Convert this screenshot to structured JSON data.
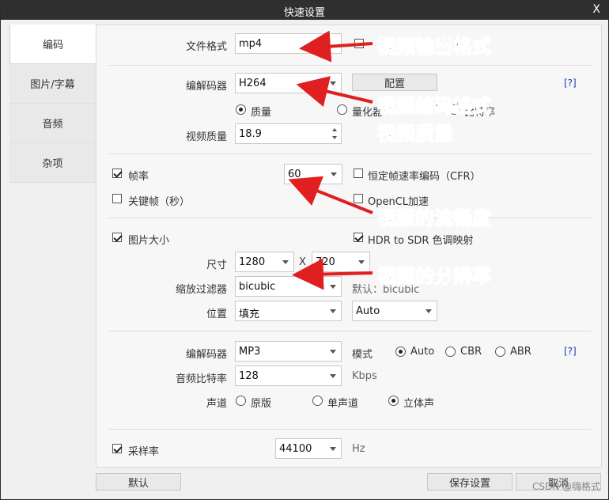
{
  "window": {
    "title": "快速设置",
    "close": "X"
  },
  "sidebar": {
    "items": [
      {
        "label": "编码"
      },
      {
        "label": "图片/字幕"
      },
      {
        "label": "音频"
      },
      {
        "label": "杂项"
      }
    ]
  },
  "video": {
    "format_label": "文件格式",
    "format_value": "mp4",
    "codec_label": "编解码器",
    "codec_value": "H264",
    "config_button": "配置",
    "help": "[?]",
    "quality_mode": {
      "quality": "质量",
      "quantizer": "量化器",
      "bitrate": "比特率"
    },
    "quality_label": "视频质量",
    "quality_value": "18.9"
  },
  "frames": {
    "fps_label": "帧率",
    "fps_value": "60",
    "keyframe_label": "关键帧（秒）",
    "cfr_label": "恒定帧速率编码（CFR）",
    "opencl_label": "OpenCL加速"
  },
  "image": {
    "size_label": "图片大小",
    "hdr_label": "HDR to SDR 色调映射",
    "dim_label": "尺寸",
    "width": "1280",
    "x_sep": "X",
    "height": "720",
    "scale_filter_label": "缩放过滤器",
    "scale_filter_value": "bicubic",
    "default_note": "默认：bicubic",
    "position_label": "位置",
    "position_value": "填充",
    "position_mode": "Auto"
  },
  "audio": {
    "codec_label": "编解码器",
    "codec_value": "MP3",
    "mode_label": "模式",
    "mode_auto": "Auto",
    "mode_cbr": "CBR",
    "mode_abr": "ABR",
    "help": "[?]",
    "bitrate_label": "音频比特率",
    "bitrate_value": "128",
    "bitrate_unit": "Kbps",
    "channel_label": "声道",
    "channel_original": "原版",
    "channel_mono": "单声道",
    "channel_stereo": "立体声"
  },
  "sample": {
    "label": "采样率",
    "value": "44100",
    "unit": "Hz"
  },
  "footer": {
    "default_button": "默认",
    "save_button": "保存设置",
    "cancel_button": "取消",
    "watermark": "CSDN @嗨格式"
  },
  "annotations": {
    "format": "视频输出格式",
    "codec": "视频编码格式",
    "quality": "视频质量",
    "fps": "视频的流畅度",
    "resolution": "视频的分辨率",
    "color": "#e02020"
  }
}
